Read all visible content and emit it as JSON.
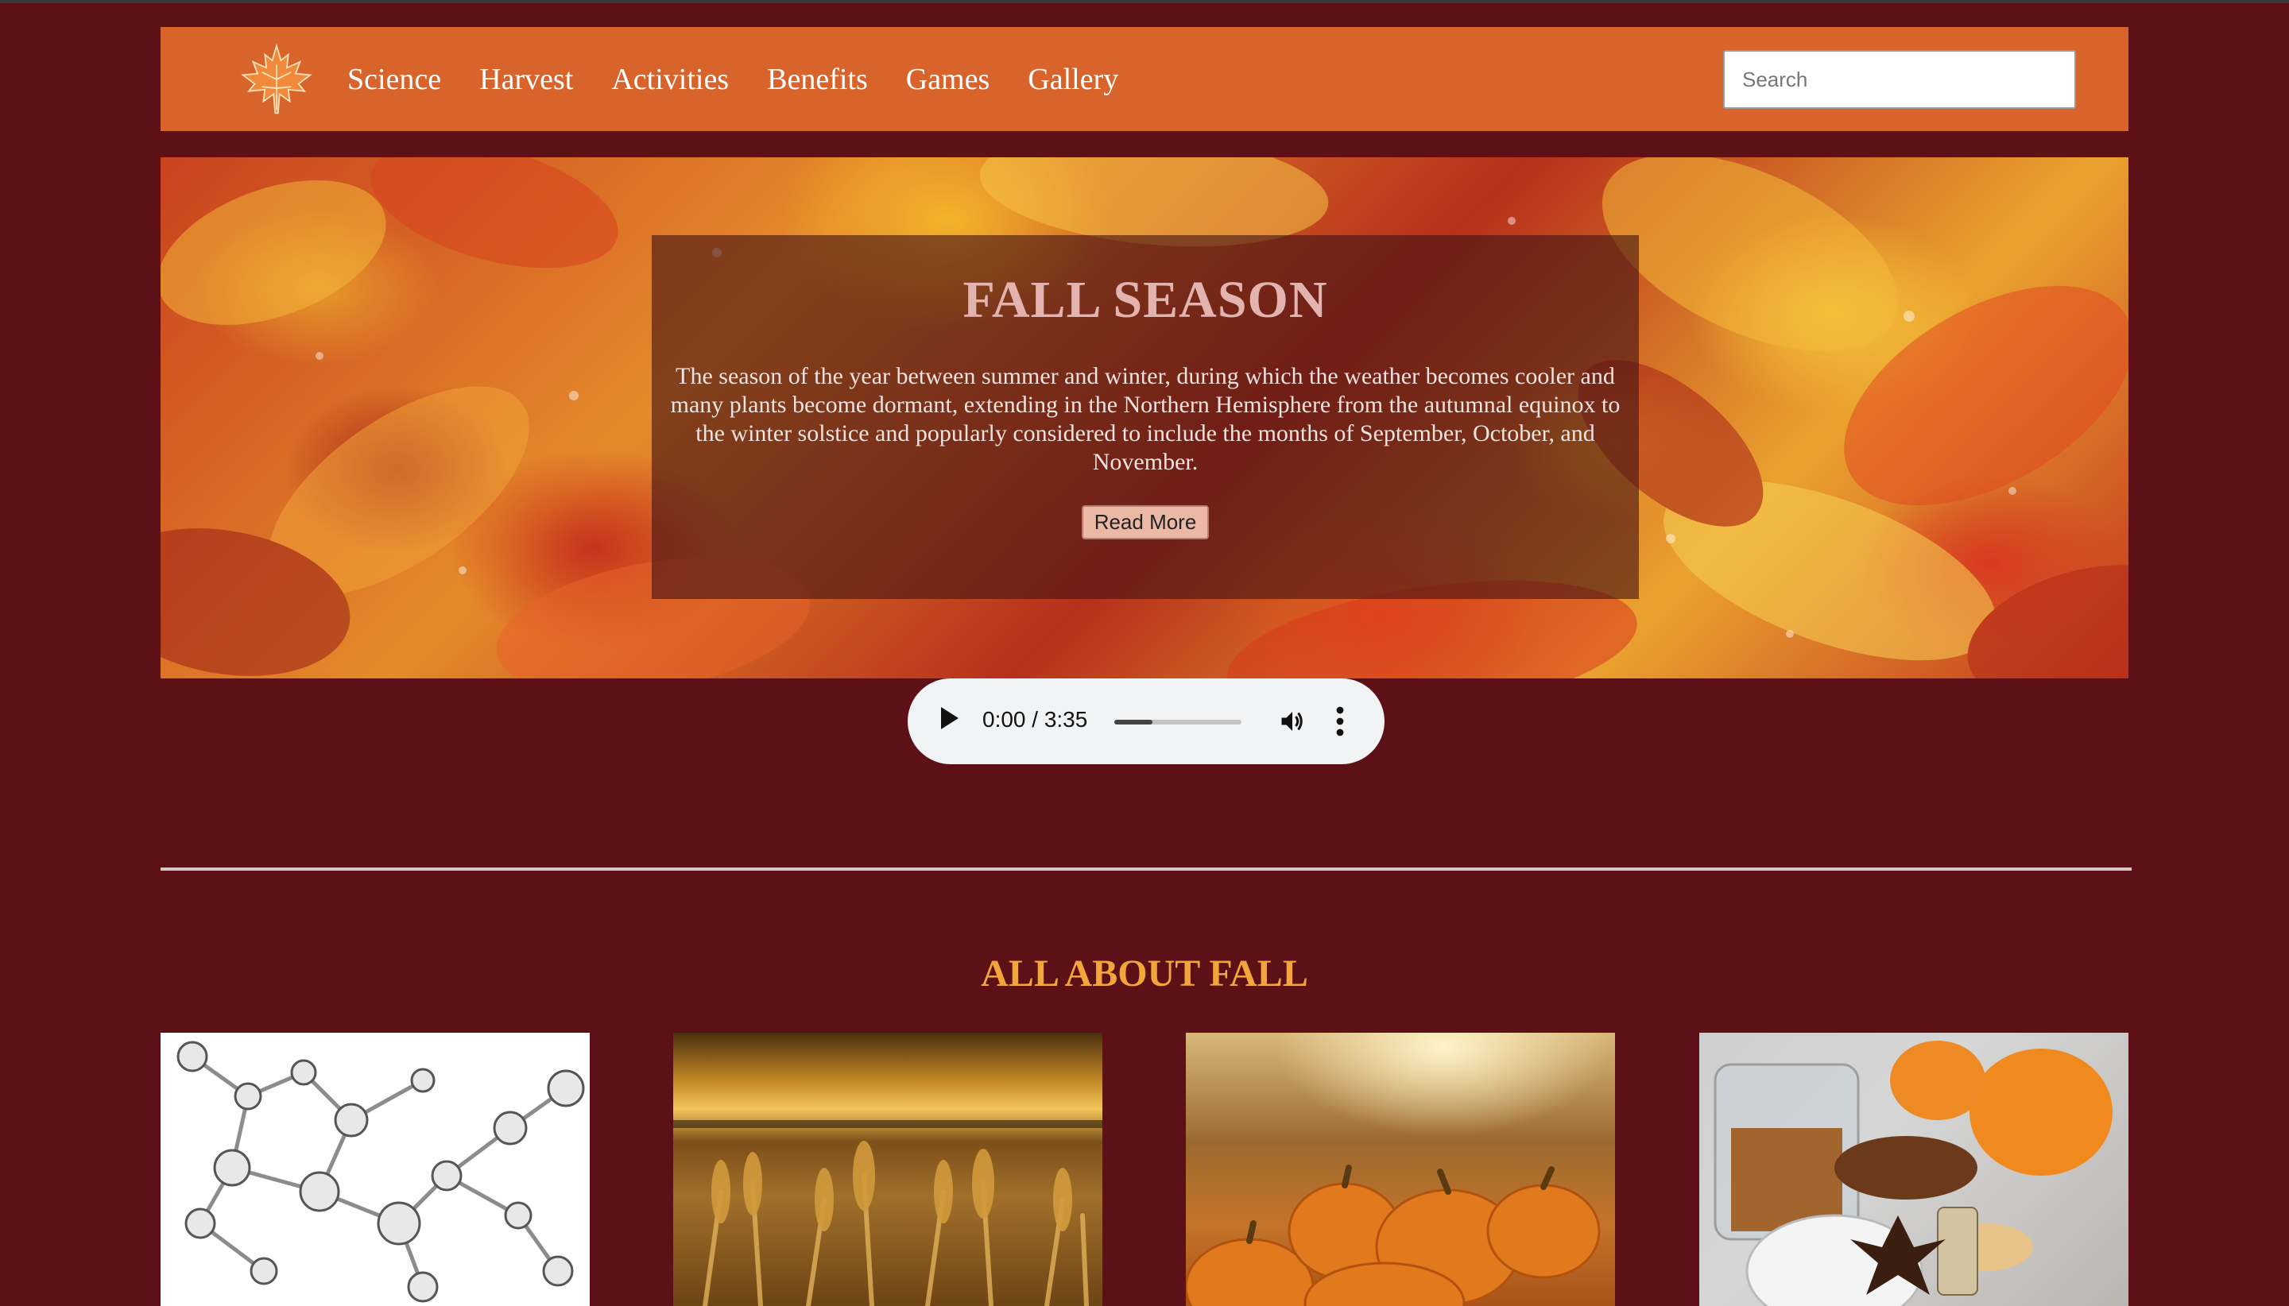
{
  "nav": {
    "logo_icon": "maple-leaf-icon",
    "links": [
      "Science",
      "Harvest",
      "Activities",
      "Benefits",
      "Games",
      "Gallery"
    ],
    "search_placeholder": "Search"
  },
  "hero": {
    "title": "FALL SEASON",
    "description": "The season of the year between summer and winter, during which the weather becomes cooler and many plants become dormant, extending in the Northern Hemisphere from the autumnal equinox to the winter solstice and popularly considered to include the months of September, October, and November.",
    "button_label": "Read More"
  },
  "audio": {
    "time_display": "0:00 / 3:35",
    "progress_fraction": 0.3,
    "play_icon": "play-icon",
    "volume_icon": "volume-icon",
    "menu_icon": "more-options-icon"
  },
  "section": {
    "title": "ALL ABOUT FALL"
  },
  "colors": {
    "page_background": "#5e1017",
    "navbar": "#d9642b",
    "section_title": "#f2a53a"
  }
}
